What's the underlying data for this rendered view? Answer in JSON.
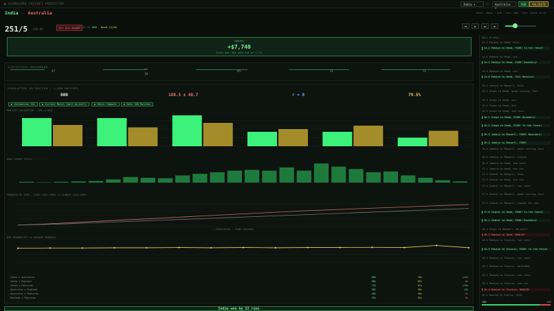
{
  "app": {
    "title": "SCORECARD CRICKET PREDICTOR"
  },
  "header": {
    "team1_select": "India",
    "team2_select": "Australia",
    "btn_run": "RUN",
    "btn_validate": "VALIDATE"
  },
  "match": {
    "team1": "India",
    "team2": "Australia",
    "score": "251/5",
    "overs": "(20.0)",
    "status_badge": "All Out Ahead",
    "meta1": "CRR 12.55",
    "meta1_val": "RRR",
    "meta2": "Need 22/0b",
    "top_right": "Pace · Home · 5/6 · Par: 188 · Pre: India 11.4%"
  },
  "win": {
    "label": "INNINGS",
    "value": "+$7,740",
    "sub": "India won! Net gain out of 1.77%"
  },
  "sections": {
    "sec1": "STATISTICAL BREAKDOWN",
    "sec2": "SIMULATION VALIDATION — 1,000 MATCHES",
    "chart1_label": "RUN DIST VALIDATION — SIM vs REAL",
    "chart2_label": "RUNS SCORED TOTALS · ·  ·  ·  ·",
    "chart3_label": "PROGRESS BY OVER — TIGHT (OLD COMP) vs SLOWEST (OLD COMP)",
    "chart4_label": "WIN PROBABILITY vs AVERAGE PROGRESS"
  },
  "stats": [
    {
      "label": "",
      "value": "47"
    },
    {
      "label": "MAX",
      "value": "18"
    },
    {
      "label": "",
      "value": "45"
    },
    {
      "label": "",
      "value": "51"
    },
    {
      "label": "",
      "value": "71"
    }
  ],
  "bignums": [
    {
      "value": "600",
      "color": "#e9f3ec"
    },
    {
      "value": "188.5 ± 48.7",
      "color": "#f07a7a"
    },
    {
      "value": "r = 0",
      "color": "#6ea8ff"
    },
    {
      "value": "79.5%",
      "color": "#f3d35b"
    }
  ],
  "chips": [
    "▶ Validation 11k",
    "▶ Current Match (ball-by-ball)",
    "▶ Match Compare",
    "▶ Date 100 Matches"
  ],
  "chart_data": [
    {
      "type": "bar",
      "categories": [
        "A",
        "B",
        "C",
        "D",
        "E",
        "F"
      ],
      "series": [
        {
          "values": [
            82,
            82,
            90,
            42,
            42,
            25
          ],
          "color": "#3df27a"
        },
        {
          "values": [
            62,
            55,
            68,
            50,
            60,
            45
          ],
          "color": "#a58c2a"
        }
      ],
      "ylim": [
        0,
        100
      ]
    },
    {
      "type": "bar",
      "values": [
        2,
        1,
        2,
        3,
        4,
        8,
        14,
        12,
        11,
        18,
        22,
        26,
        30,
        32,
        30,
        38,
        30,
        48,
        40,
        34,
        26,
        28,
        18,
        12,
        6,
        3
      ],
      "color": "#1e7a3c",
      "ylim": [
        0,
        55
      ]
    },
    {
      "type": "line",
      "series": [
        {
          "name": "Simulation",
          "values": [
            5,
            8,
            12,
            16,
            20,
            24,
            28,
            32,
            36,
            40,
            44,
            48,
            52,
            55,
            58,
            61,
            64,
            67,
            70,
            73
          ],
          "color": "#c96a6a"
        },
        {
          "name": "Tight matches",
          "values": [
            5,
            7,
            9,
            12,
            15,
            18,
            21,
            24,
            27,
            30,
            33,
            36,
            39,
            42,
            45,
            48,
            51,
            54,
            57,
            60
          ],
          "color": "#777777"
        }
      ],
      "ylim": [
        0,
        100
      ]
    },
    {
      "type": "line",
      "series": [
        {
          "values": [
            60,
            61,
            61,
            62,
            62,
            63,
            62,
            63,
            62,
            63,
            63,
            64,
            63,
            72,
            62
          ],
          "color": "#f3d35b"
        }
      ],
      "ylim": [
        0,
        100
      ]
    }
  ],
  "table": {
    "headers": [
      "",
      "",
      "",
      ""
    ],
    "rows": [
      [
        "India v Australia",
        "66%",
        "70%",
        "+11%"
      ],
      [
        "India v England",
        "58%",
        "65%",
        "-8%"
      ],
      [
        "India v Pakistan",
        "73%",
        "61%",
        "+14%"
      ],
      [
        "Australia v England",
        "58%",
        "56%",
        "+2%"
      ],
      [
        "Australia v Pakistan",
        "48%",
        "50%",
        "-3%"
      ],
      [
        "England v Pakistan",
        "53%",
        "55%",
        "-4%"
      ]
    ]
  },
  "events": [
    {
      "text": "14.2 Pandya to Head, Risk.",
      "type": ""
    },
    {
      "text": "14.2 Pandya to Head, FOUR! To the fence!",
      "type": "four"
    },
    {
      "text": "14.3 Pandya to Head, ont.",
      "type": ""
    },
    {
      "text": "14.4 Pandya to Head, FOUR! Boundary!",
      "type": "four"
    },
    {
      "text": "14.5 Pandya to Head, ont.",
      "type": ""
    },
    {
      "text": "14.6 Pandya to Head, SIX! Massive!",
      "type": "six"
    },
    {
      "text": "15.1 Jadeja to Maxwell, Risk.",
      "type": ""
    },
    {
      "text": "15.2 Singh to Head, good running, Run!",
      "type": ""
    },
    {
      "text": "15.3 Singh to Head, ont.",
      "type": ""
    },
    {
      "text": "15.4 Singh to Head, ont.",
      "type": ""
    },
    {
      "text": "15.5 Singh to Head, two runs!",
      "type": ""
    },
    {
      "text": "16.1 Singh to Head, FOUR! Boundary!",
      "type": "four"
    },
    {
      "text": "16.2 Singh to Head, FOUR! To the fence!",
      "type": "four"
    },
    {
      "text": "16.3 Jadeja to Maxwell, FOUR! Boundary!",
      "type": "four"
    },
    {
      "text": "16.4 Jadeja to Maxwell, FOUR!",
      "type": "four"
    },
    {
      "text": "16.5 Jadeja to Maxwell, good running, Run!",
      "type": ""
    },
    {
      "text": "16.6 Jadeja to Maxwell, single.",
      "type": ""
    },
    {
      "text": "16.6 Jadeja to Head, two runs!",
      "type": ""
    },
    {
      "text": "17.1 Jadeja to Head, one run.",
      "type": ""
    },
    {
      "text": "17.2 Chahal to Maxwell, Risk.",
      "type": ""
    },
    {
      "text": "17.3 Chahal to Head, one run.",
      "type": ""
    },
    {
      "text": "17.4 Chahal to Maxwell, two runs!",
      "type": ""
    },
    {
      "text": "17.5 Chahal to Maxwell, good running, Run!",
      "type": ""
    },
    {
      "text": "17.6 Chahal to Maxwell, scoops for one.",
      "type": ""
    },
    {
      "text": "17.6 Chahal to Head, FOUR! To the fence!",
      "type": "four"
    },
    {
      "text": "18.1 Chahal to Head, FOUR! Boundary!",
      "type": "four"
    },
    {
      "text": "18.2 Singh to Maxwell, No ball!",
      "type": ""
    },
    {
      "text": "18.3 Pandya to Head, BOWLED!",
      "type": "wkt"
    },
    {
      "text": "18.4 Pandya to Stoinis, two runs!",
      "type": ""
    },
    {
      "text": "18.5 Pandya to Stoinis, FOUR! To the fence!",
      "type": "four"
    },
    {
      "text": "18.6 Pandya to Stoinis, two runs!",
      "type": ""
    },
    {
      "text": "19.1 Pandya to Stoinis, defended.",
      "type": ""
    },
    {
      "text": "19.2 Pandya to Stoinis, two runs!",
      "type": ""
    },
    {
      "text": "19.3 Pandya to Stoinis, one run.",
      "type": ""
    },
    {
      "text": "19.4 Bumrah to Stoinis, BOWLED!",
      "type": "wkt"
    },
    {
      "text": "19.5 Bumrah to Inglis, Risk.",
      "type": ""
    },
    {
      "text": "19.6 Bumrah to Inglis, FOUR! Boundary!",
      "type": "four"
    },
    {
      "text": "20.1 Bumrah to Inglis, Risk.",
      "type": ""
    },
    {
      "text": "20.2 Bumrah to Inglis, Risk.",
      "type": ""
    },
    {
      "text": "20.3 Bumrah to Inglis, single.",
      "type": ""
    },
    {
      "text": "20.4 Bumrah to Maxwell, BOWLED!",
      "type": "wkt"
    },
    {
      "text": "20.5 Bumrah to David, one run.",
      "type": ""
    },
    {
      "text": "20.6 Bumrah to Inglis, No ball!",
      "type": ""
    },
    {
      "text": "20.6 Bumrah to Inglis, one run.",
      "type": ""
    },
    {
      "text": "20.6 Bumrah to David, one run.",
      "type": ""
    }
  ],
  "side_title": "BALL-BY-BALL",
  "side_bottom": {
    "left": "IND",
    "right": "AUS",
    "win_prob": 0.84
  },
  "footer": "India won by 22 runs"
}
